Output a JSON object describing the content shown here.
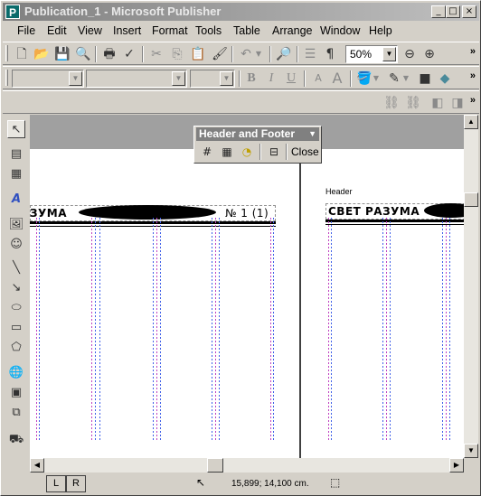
{
  "window": {
    "title": "Publication_1 - Microsoft Publisher",
    "app_icon": "P",
    "controls": {
      "minimize": "_",
      "maximize": "□",
      "close": "×"
    }
  },
  "menu": [
    "File",
    "Edit",
    "View",
    "Insert",
    "Format",
    "Tools",
    "Table",
    "Arrange",
    "Window",
    "Help"
  ],
  "standard_toolbar": {
    "zoom": "50%",
    "icons": [
      "new-icon",
      "open-icon",
      "save-icon",
      "print-preview-icon",
      "print-icon",
      "spelling-icon",
      "cut-icon",
      "copy-icon",
      "paste-icon",
      "format-painter-icon",
      "undo-icon",
      "redo-icon",
      "web-preview-icon",
      "columns-icon",
      "paragraph-marks-icon",
      "zoom-out-icon",
      "zoom-in-icon"
    ]
  },
  "formatting_toolbar": {
    "style": "",
    "font": "",
    "size": "",
    "bold": "B",
    "italic": "I",
    "underline": "U"
  },
  "header_footer_toolbar": {
    "title": "Header and Footer",
    "close_label": "Close"
  },
  "page_left": {
    "header_text": "ЗУМА",
    "issue_text": "№ 1 (1)"
  },
  "page_right": {
    "header_label": "Header",
    "header_text": "СВЕТ РАЗУМА"
  },
  "statusbar": {
    "page_tabs": [
      "L",
      "R"
    ],
    "position": "15,899; 14,100 cm."
  },
  "colors": {
    "guide_blue": "#4060e8",
    "guide_pink": "#c040c0",
    "workspace": "#a0a0a0"
  }
}
